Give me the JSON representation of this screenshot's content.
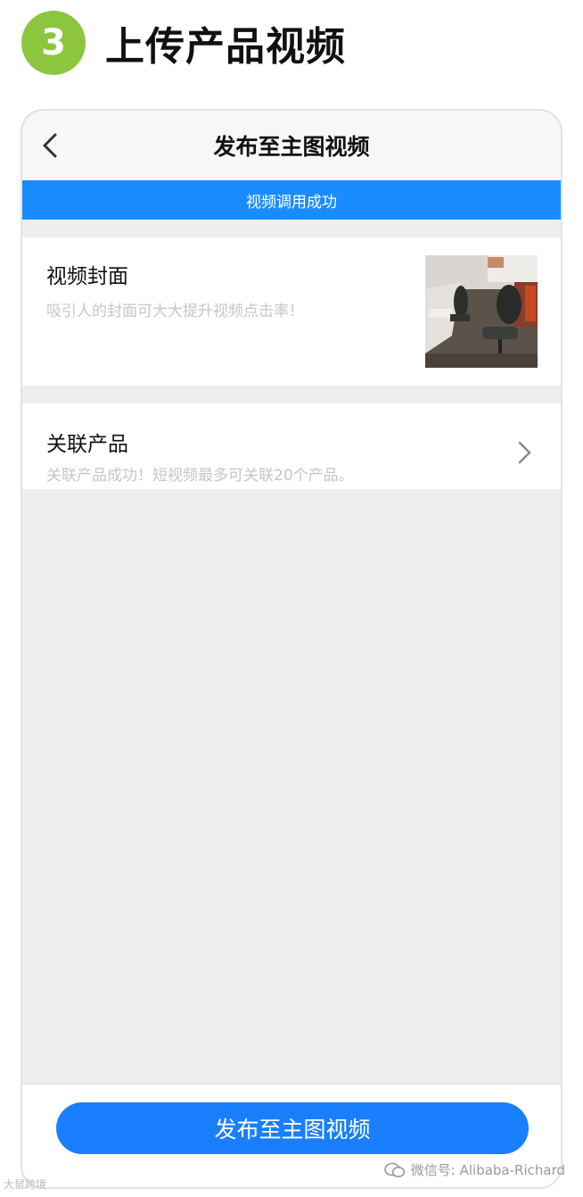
{
  "step": {
    "number": "3",
    "title": "上传产品视频",
    "badge_color": "#8cc63f"
  },
  "nav": {
    "title": "发布至主图视频",
    "back_icon": "chevron-left-icon"
  },
  "banner": {
    "text": "视频调用成功",
    "color": "#1a8cff"
  },
  "cover": {
    "title": "视频封面",
    "subtitle": "吸引人的封面可大大提升视频点击率！"
  },
  "related_products": {
    "title": "关联产品",
    "subtitle": "关联产品成功！短视频最多可关联20个产品。",
    "arrow_icon": "chevron-right-icon"
  },
  "footer": {
    "publish_label": "发布至主图视频",
    "button_color": "#1a7fff"
  },
  "watermarks": {
    "wechat": "微信号: Alibaba-Richard",
    "left": "大鼠跨境"
  }
}
